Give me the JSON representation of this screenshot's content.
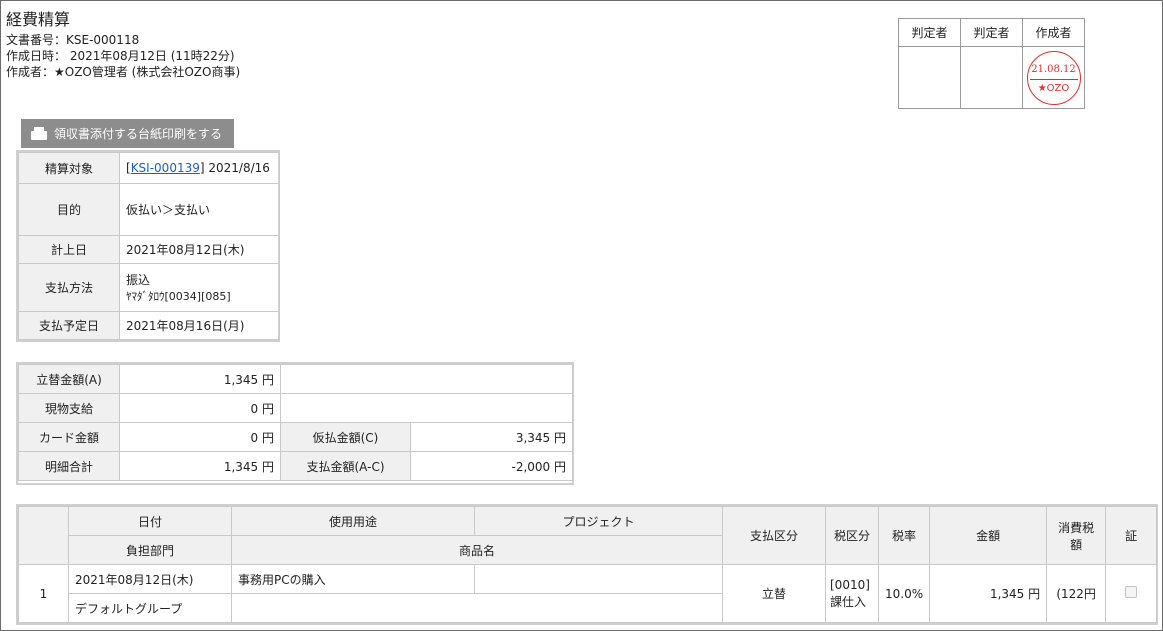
{
  "header": {
    "title": "経費精算",
    "doc_no": "文書番号：KSE-000118",
    "created_at": "作成日時： 2021年08月12日 (11時22分)",
    "author": "作成者：★OZO管理者 (株式会社OZO商事)"
  },
  "approval": {
    "col1": "判定者",
    "col2": "判定者",
    "col3": "作成者",
    "stamp_date": "21.08.12",
    "stamp_name": "★OZO",
    "stamp_color": "#e0302a"
  },
  "print_button": {
    "label": "領収書添付する台紙印刷をする"
  },
  "info": {
    "target_label": "精算対象",
    "target_bracket_open": "[",
    "target_link": "KSI-000139",
    "target_rest": "] 2021/8/16",
    "purpose_label": "目的",
    "purpose": "仮払い＞支払い",
    "date_label": "計上日",
    "date": "2021年08月12日(木)",
    "method_label": "支払方法",
    "method": "振込",
    "method_detail": "ﾔﾏﾀﾞﾀﾛｳ[0034][085]",
    "due_label": "支払予定日",
    "due": "2021年08月16日(月)"
  },
  "amounts": {
    "advance_label": "立替金額(A)",
    "advance": "1,345 円",
    "goods_label": "現物支給",
    "goods": "0 円",
    "card_label": "カード金額",
    "card": "0 円",
    "prepay_label": "仮払金額(C)",
    "prepay": "3,345 円",
    "total_label": "明細合計",
    "total": "1,345 円",
    "pay_label": "支払金額(A-C)",
    "pay": "-2,000 円"
  },
  "detail": {
    "headers": {
      "date": "日付",
      "usage": "使用用途",
      "project": "プロジェクト",
      "dept": "負担部門",
      "item": "商品名",
      "pay_type": "支払区分",
      "tax_type": "税区分",
      "tax_rate": "税率",
      "amount": "金額",
      "tax": "消費税額",
      "proof": "証"
    },
    "rows": [
      {
        "no": "1",
        "date": "2021年08月12日(木)",
        "usage": "事務用PCの購入",
        "project": "",
        "dept": "デフォルトグループ",
        "item": "",
        "pay_type": "立替",
        "tax_code": "[0010]",
        "tax_name": "課仕入",
        "tax_rate": "10.0%",
        "amount": "1,345 円",
        "tax": "(122円"
      }
    ]
  }
}
